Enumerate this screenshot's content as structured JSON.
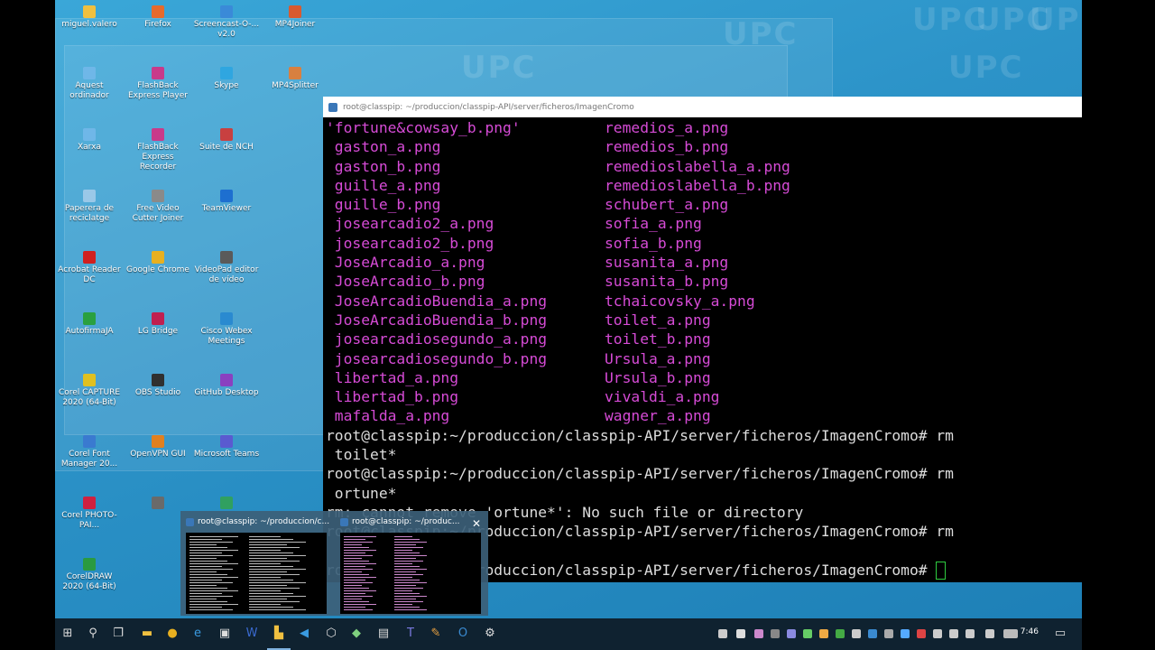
{
  "desktop": {
    "watermark_text": "UPC",
    "icons": [
      {
        "label": "miguel.valero",
        "color": "#f0c040"
      },
      {
        "label": "Firefox",
        "color": "#e66a2c"
      },
      {
        "label": "Screencast-O-... v2.0",
        "color": "#3a8ad8"
      },
      {
        "label": "MP4Joiner",
        "color": "#d85a30"
      },
      {
        "label": "Aquest ordinador",
        "color": "#6fb7e8"
      },
      {
        "label": "FlashBack Express Player",
        "color": "#c83a8a"
      },
      {
        "label": "Skype",
        "color": "#2fa6e0"
      },
      {
        "label": "MP4Splitter",
        "color": "#d88040"
      },
      {
        "label": "Xarxa",
        "color": "#6fb7e8"
      },
      {
        "label": "FlashBack Express Recorder",
        "color": "#c83a8a"
      },
      {
        "label": "Suite de NCH",
        "color": "#c84040"
      },
      {
        "label": "Paperera de reciclatge",
        "color": "#9ac8e8"
      },
      {
        "label": "Free Video Cutter Joiner",
        "color": "#8a8a8a"
      },
      {
        "label": "TeamViewer",
        "color": "#1d6fd0"
      },
      {
        "label": "Acrobat Reader DC",
        "color": "#d02020"
      },
      {
        "label": "Google Chrome",
        "color": "#e8b020"
      },
      {
        "label": "VideoPad editor de vídeo",
        "color": "#5a5a5a"
      },
      {
        "label": "AutofirmaJA",
        "color": "#2aa040"
      },
      {
        "label": "LG Bridge",
        "color": "#c02050"
      },
      {
        "label": "Cisco Webex Meetings",
        "color": "#2a8ad0"
      },
      {
        "label": "Corel CAPTURE 2020 (64-Bit)",
        "color": "#e0c020"
      },
      {
        "label": "OBS Studio",
        "color": "#303030"
      },
      {
        "label": "GitHub Desktop",
        "color": "#8a40c0"
      },
      {
        "label": "Corel Font Manager 20...",
        "color": "#3a7ad0"
      },
      {
        "label": "OpenVPN GUI",
        "color": "#e08020"
      },
      {
        "label": "Microsoft Teams",
        "color": "#5a5ad0"
      },
      {
        "label": "Corel PHOTO-PAI...",
        "color": "#d02040"
      },
      {
        "label": "",
        "color": "#6a6a6a"
      },
      {
        "label": "",
        "color": "#30a060"
      },
      {
        "label": "CorelDRAW 2020 (64-Bit)",
        "color": "#2a9a40"
      }
    ]
  },
  "terminal": {
    "title": "root@classpip: ~/produccion/classpip-API/server/ficheros/ImagenCromo",
    "files_left": [
      "'fortune&cowsay_b.png'",
      " gaston_a.png",
      " gaston_b.png",
      " guille_a.png",
      " guille_b.png",
      " josearcadio2_a.png",
      " josearcadio2_b.png",
      " JoseArcadio_a.png",
      " JoseArcadio_b.png",
      " JoseArcadioBuendia_a.png",
      " JoseArcadioBuendia_b.png",
      " josearcadiosegundo_a.png",
      " josearcadiosegundo_b.png",
      " libertad_a.png",
      " libertad_b.png",
      " mafalda_a.png"
    ],
    "files_right": [
      "remedios_a.png",
      "remedios_b.png",
      "remedioslabella_a.png",
      "remedioslabella_b.png",
      "schubert_a.png",
      "sofia_a.png",
      "sofia_b.png",
      "susanita_a.png",
      "susanita_b.png",
      "tchaicovsky_a.png",
      "toilet_a.png",
      "toilet_b.png",
      "Ursula_a.png",
      "Ursula_b.png",
      "vivaldi_a.png",
      "wagner_a.png"
    ],
    "lines": [
      "root@classpip:~/produccion/classpip-API/server/ficheros/ImagenCromo# rm",
      " toilet*",
      "root@classpip:~/produccion/classpip-API/server/ficheros/ImagenCromo# rm",
      " ortune*",
      "rm: cannot remove 'ortune*': No such file or directory",
      "root@classpip:~/produccion/classpip-API/server/ficheros/ImagenCromo# rm",
      "",
      "root@classpip:~/produccion/classpip-API/server/ficheros/ImagenCromo# "
    ]
  },
  "thumbnails": [
    {
      "title": "root@classpip: ~/produccion/c..."
    },
    {
      "title": "root@classpip: ~/produc..."
    }
  ],
  "taskbar": {
    "clock": "7:46"
  }
}
